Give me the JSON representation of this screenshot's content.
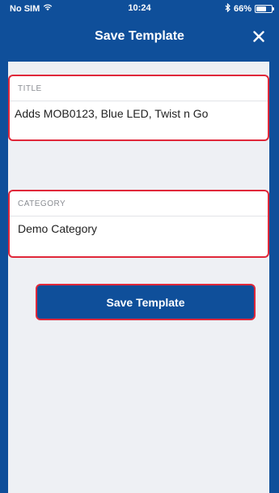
{
  "status_bar": {
    "carrier": "No SIM",
    "time": "10:24",
    "battery_percent": "66%",
    "battery_level": 0.66
  },
  "nav": {
    "title": "Save Template",
    "close_icon": "close-icon"
  },
  "form": {
    "title_field": {
      "label": "TITLE",
      "value": "Adds MOB0123, Blue LED, Twist n Go"
    },
    "category_field": {
      "label": "CATEGORY",
      "value": "Demo Category"
    },
    "save_button_label": "Save Template"
  },
  "colors": {
    "brand_blue": "#0f4f9a",
    "highlight_red": "#e0283a",
    "content_background": "#eef0f4"
  }
}
